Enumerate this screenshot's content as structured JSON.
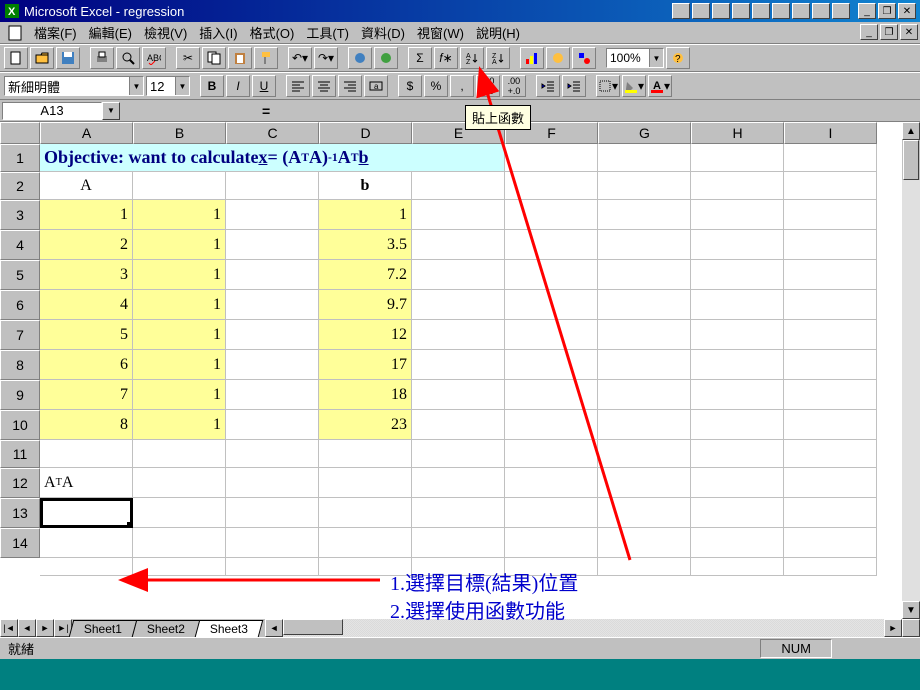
{
  "title": "Microsoft Excel - regression",
  "menus": {
    "file": "檔案(F)",
    "edit": "編輯(E)",
    "view": "檢視(V)",
    "insert": "插入(I)",
    "format": "格式(O)",
    "tools": "工具(T)",
    "data": "資料(D)",
    "window": "視窗(W)",
    "help": "說明(H)"
  },
  "toolbar": {
    "zoom": "100%"
  },
  "format": {
    "font_name": "新細明體",
    "font_size": "12"
  },
  "namebox": {
    "ref": "A13",
    "formula": "="
  },
  "tooltip": {
    "paste_function": "貼上函數"
  },
  "columns": [
    "A",
    "B",
    "C",
    "D",
    "E",
    "F",
    "G",
    "H",
    "I"
  ],
  "rows": [
    "1",
    "2",
    "3",
    "4",
    "5",
    "6",
    "7",
    "8",
    "9",
    "10",
    "11",
    "12",
    "13",
    "14"
  ],
  "content": {
    "objective_prefix": "Objective: want to calculate  ",
    "obj_x": "x",
    "obj_eq": " = (A",
    "obj_T1": "T",
    "obj_A": "A)",
    "obj_inv": "-1",
    "obj_A2": "A",
    "obj_T2": "T",
    "obj_b": "b",
    "header_A": "A",
    "header_b": "b",
    "A12_label": "A",
    "A12_T": "T",
    "A12_A2": "A",
    "col_A": [
      "1",
      "2",
      "3",
      "4",
      "5",
      "6",
      "7",
      "8"
    ],
    "col_B": [
      "1",
      "1",
      "1",
      "1",
      "1",
      "1",
      "1",
      "1"
    ],
    "col_D": [
      "1",
      "3.5",
      "7.2",
      "9.7",
      "12",
      "17",
      "18",
      "23"
    ]
  },
  "sheets": {
    "s1": "Sheet1",
    "s2": "Sheet2",
    "s3": "Sheet3"
  },
  "status": {
    "ready": "就緒",
    "num": "NUM"
  },
  "annotations": {
    "line1": "1.選擇目標(結果)位置",
    "line2": "2.選擇使用函數功能"
  }
}
